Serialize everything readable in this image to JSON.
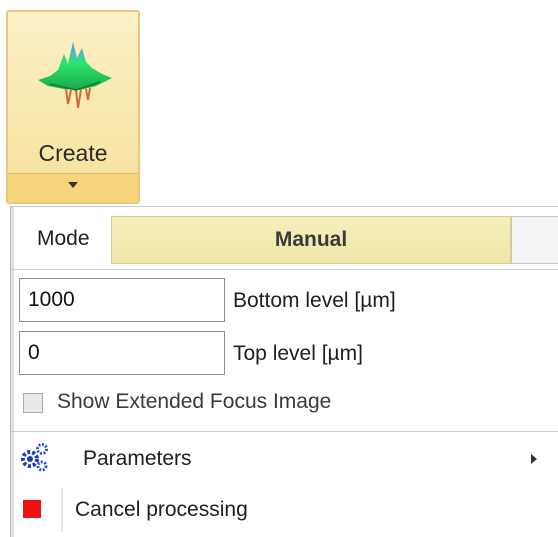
{
  "ribbon": {
    "create_label": "Create",
    "create_icon": "surface-3d-icon",
    "dropdown_icon": "chevron-down-icon"
  },
  "mode": {
    "label": "Mode",
    "selected": "Manual",
    "accent_color": "#f2ebb3"
  },
  "fields": {
    "bottom_level": {
      "value": "1000",
      "label": "Bottom level [µm]"
    },
    "top_level": {
      "value": "0",
      "label": "Top level [µm]"
    }
  },
  "extended_focus": {
    "label": "Show Extended Focus Image",
    "checked": false
  },
  "menu": {
    "parameters": {
      "label": "Parameters",
      "icon": "gears-icon",
      "submenu_icon": "chevron-right-icon"
    },
    "cancel": {
      "label": "Cancel processing",
      "icon": "stop-icon",
      "icon_color": "#ee1111"
    }
  }
}
